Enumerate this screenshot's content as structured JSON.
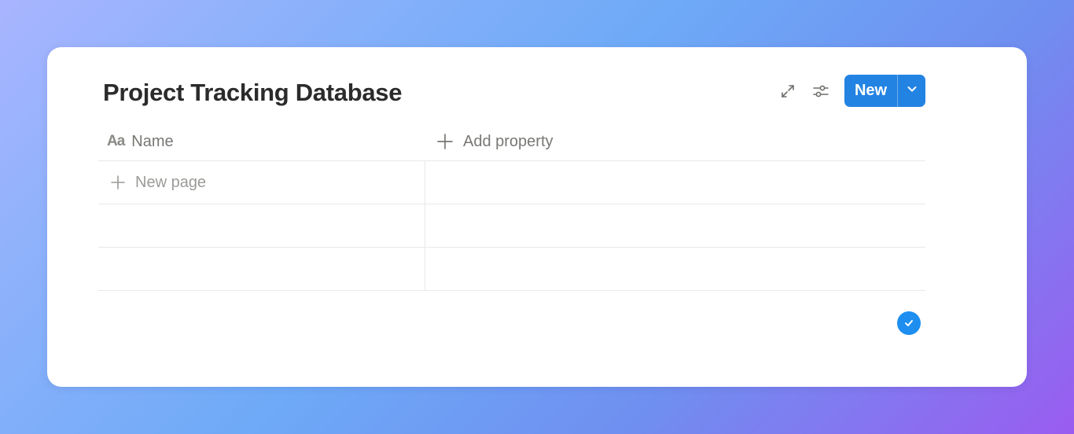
{
  "page": {
    "title": "Project Tracking Database"
  },
  "toolbar": {
    "icons": [
      "expand-icon",
      "settings-sliders-icon"
    ],
    "new_label": "New",
    "new_caret_icon": "chevron-down-icon"
  },
  "table": {
    "columns": [
      {
        "label": "Name",
        "icon": "Aa"
      },
      {
        "label": "Add property",
        "icon": "plus-icon"
      }
    ],
    "new_page_label": "New page",
    "empty_rows": 2
  },
  "status": {
    "icon": "check-circle-icon"
  },
  "colors": {
    "accent": "#2383e2",
    "badge": "#1e8ef0",
    "title_text": "#2b2b2b",
    "muted_text": "#787774",
    "border": "#e9e9e7"
  }
}
